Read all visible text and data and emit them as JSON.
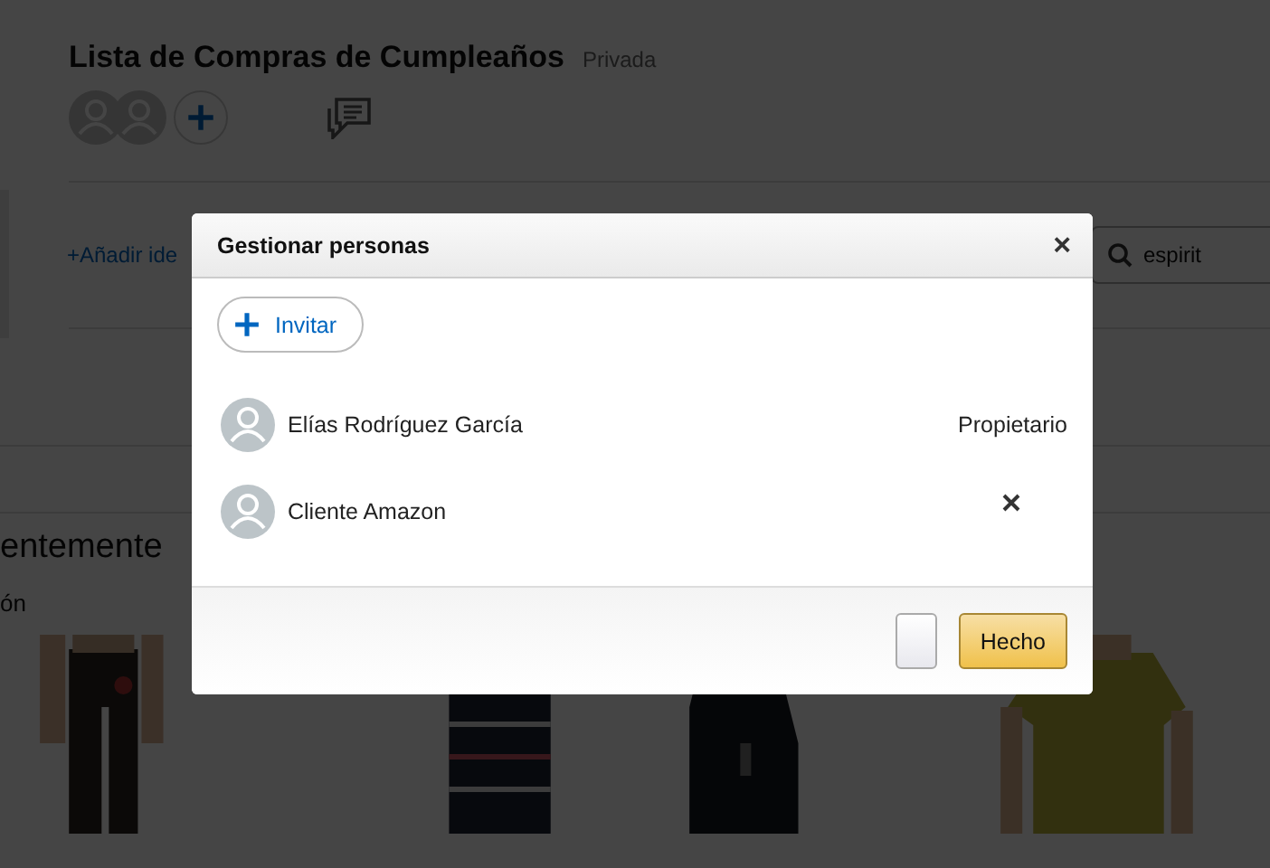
{
  "list": {
    "title": "Lista de Compras de Cumpleaños",
    "privacy": "Privada"
  },
  "add_idea": "+Añadir ide",
  "search": {
    "value": "espirit"
  },
  "section": {
    "heading": "entemente",
    "subheading": "ón"
  },
  "dialog": {
    "title": "Gestionar personas",
    "close": "×",
    "invite": "Invitar",
    "people": [
      {
        "name": "Elías Rodríguez García",
        "role": "Propietario",
        "removable": false
      },
      {
        "name": "Cliente Amazon",
        "removable": true
      }
    ],
    "done": "Hecho"
  }
}
